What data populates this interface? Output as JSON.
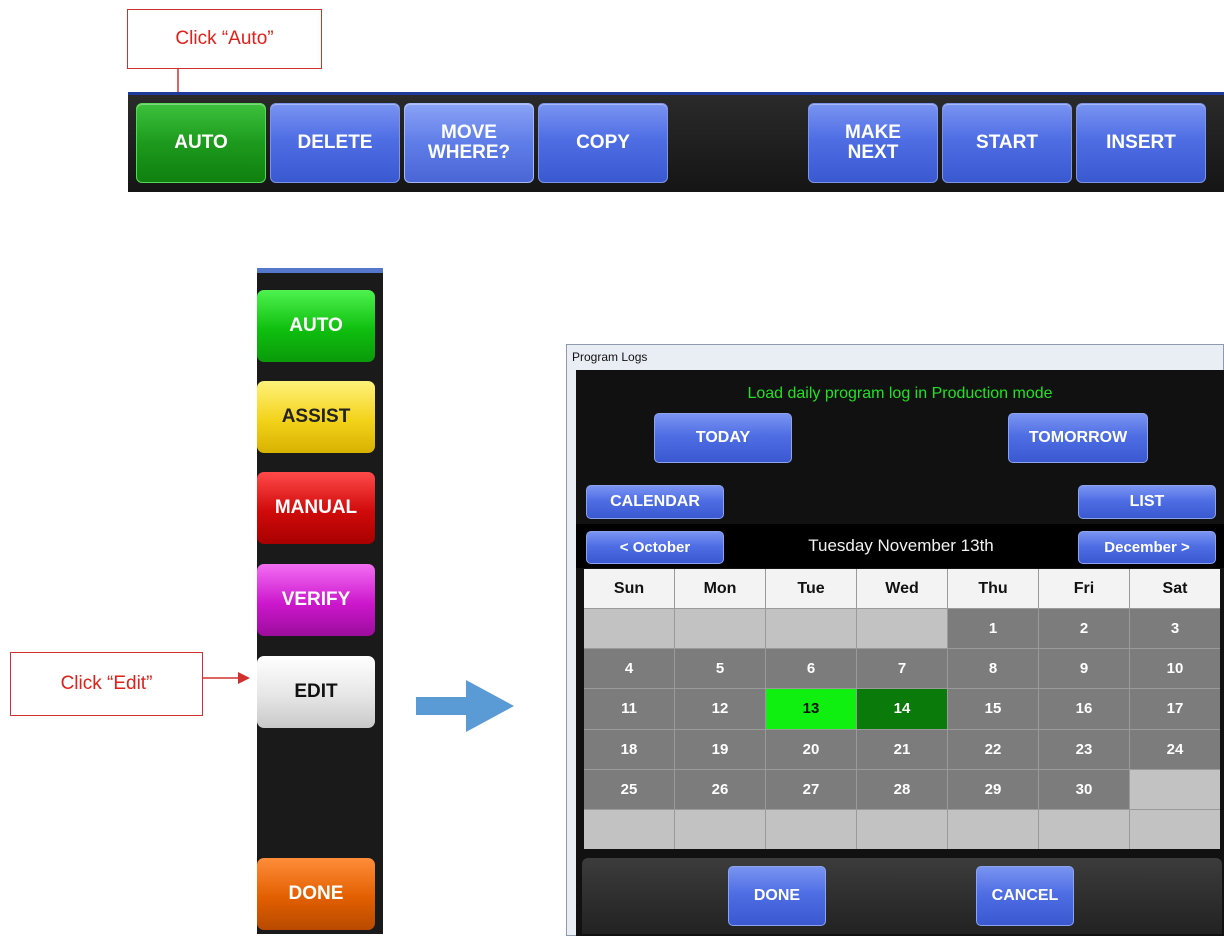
{
  "callouts": {
    "auto": "Click “Auto”",
    "edit": "Click “Edit”"
  },
  "toolbar": {
    "auto": "AUTO",
    "delete": "DELETE",
    "move_where_line1": "MOVE",
    "move_where_line2": "WHERE?",
    "copy": "COPY",
    "make_next_line1": "MAKE",
    "make_next_line2": "NEXT",
    "start": "START",
    "insert": "INSERT"
  },
  "mode_panel": {
    "auto": "AUTO",
    "assist": "ASSIST",
    "manual": "MANUAL",
    "verify": "VERIFY",
    "edit": "EDIT",
    "done": "DONE"
  },
  "dialog": {
    "title": "Program Logs",
    "subtitle": "Load daily program log in Production mode",
    "today_button": "TODAY",
    "tomorrow_button": "TOMORROW",
    "calendar_button": "CALENDAR",
    "list_button": "LIST",
    "prev_month_button": "< October",
    "next_month_button": "December >",
    "selected_date": "Tuesday November 13th",
    "done_button": "DONE",
    "cancel_button": "CANCEL",
    "calendar": {
      "weekdays": [
        "Sun",
        "Mon",
        "Tue",
        "Wed",
        "Thu",
        "Fri",
        "Sat"
      ],
      "weeks": [
        [
          "",
          "",
          "",
          "",
          "1",
          "2",
          "3"
        ],
        [
          "4",
          "5",
          "6",
          "7",
          "8",
          "9",
          "10"
        ],
        [
          "11",
          "12",
          "13",
          "14",
          "15",
          "16",
          "17"
        ],
        [
          "18",
          "19",
          "20",
          "21",
          "22",
          "23",
          "24"
        ],
        [
          "25",
          "26",
          "27",
          "28",
          "29",
          "30",
          ""
        ],
        [
          "",
          "",
          "",
          "",
          "",
          "",
          ""
        ]
      ],
      "today_day": "13",
      "tomorrow_day": "14",
      "colors": {
        "today": "#10f010",
        "tomorrow": "#0a7a0a",
        "filled": "#7c7c7c",
        "empty": "#c2c2c2"
      }
    }
  }
}
